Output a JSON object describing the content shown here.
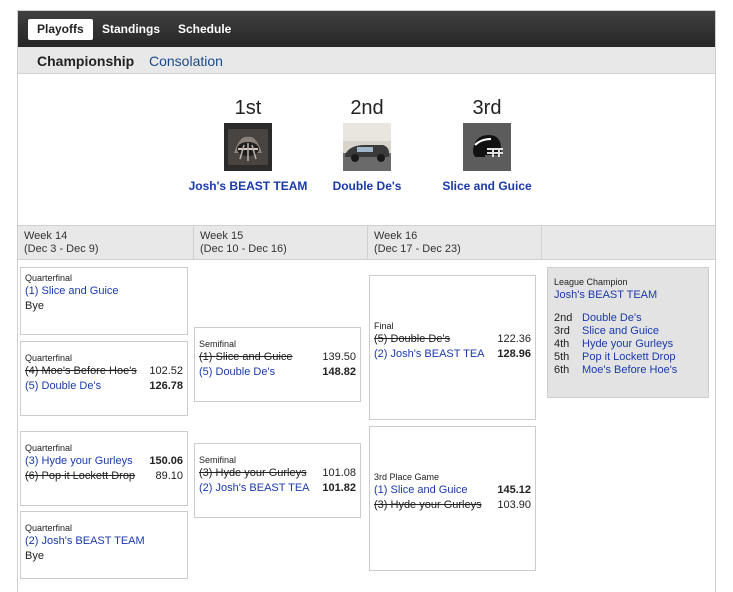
{
  "topnav": {
    "tabs": [
      {
        "label": "Playoffs"
      },
      {
        "label": "Standings"
      },
      {
        "label": "Schedule"
      }
    ]
  },
  "subnav": {
    "championship": "Championship",
    "consolation": "Consolation"
  },
  "podium": [
    {
      "place": "1st",
      "team": "Josh's BEAST TEAM"
    },
    {
      "place": "2nd",
      "team": "Double De's"
    },
    {
      "place": "3rd",
      "team": "Slice and Guice"
    }
  ],
  "weeks": [
    {
      "label": "Week 14",
      "range": "(Dec 3 - Dec 9)"
    },
    {
      "label": "Week 15",
      "range": "(Dec 10 - Dec 16)"
    },
    {
      "label": "Week 16",
      "range": "(Dec 17 - Dec 23)"
    }
  ],
  "matchups": {
    "qf1": {
      "round": "Quarterfinal",
      "team1": "(1) Slice and Guice",
      "bye": "Bye"
    },
    "qf2": {
      "round": "Quarterfinal",
      "team1": "(4) Moe's Before Hoe's",
      "score1": "102.52",
      "team2": "(5) Double De's",
      "score2": "126.78"
    },
    "qf3": {
      "round": "Quarterfinal",
      "team1": "(3) Hyde your Gurleys",
      "score1": "150.06",
      "team2": "(6) Pop it Lockett Drop",
      "score2": "89.10"
    },
    "qf4": {
      "round": "Quarterfinal",
      "team1": "(2) Josh's BEAST TEAM",
      "bye": "Bye"
    },
    "sf1": {
      "round": "Semifinal",
      "team1": "(1) Slice and Guice",
      "score1": "139.50",
      "team2": "(5) Double De's",
      "score2": "148.82"
    },
    "sf2": {
      "round": "Semifinal",
      "team1": "(3) Hyde your Gurleys",
      "score1": "101.08",
      "team2": "(2) Josh's BEAST TEA",
      "score2": "101.82"
    },
    "final": {
      "round": "Final",
      "team1": "(5) Double De's",
      "score1": "122.36",
      "team2": "(2) Josh's BEAST TEA",
      "score2": "128.96"
    },
    "third": {
      "round": "3rd Place Game",
      "team1": "(1) Slice and Guice",
      "score1": "145.12",
      "team2": "(3) Hyde your Gurleys",
      "score2": "103.90"
    }
  },
  "champion": {
    "header": "League Champion",
    "winner": "Josh's BEAST TEAM",
    "standings": [
      {
        "place": "2nd",
        "team": "Double De's"
      },
      {
        "place": "3rd",
        "team": "Slice and Guice"
      },
      {
        "place": "4th",
        "team": "Hyde your Gurleys"
      },
      {
        "place": "5th",
        "team": "Pop it Lockett Drop"
      },
      {
        "place": "6th",
        "team": "Moe's Before Hoe's"
      }
    ]
  }
}
